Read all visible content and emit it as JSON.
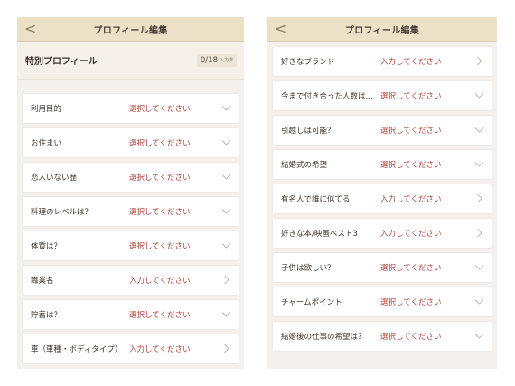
{
  "left_screen": {
    "header": {
      "title": "プロフィール編集",
      "back_icon": "back-chevron-icon"
    },
    "special": {
      "title": "特別プロフィール",
      "count": "0/18",
      "count_suffix": "入力済"
    },
    "rows": [
      {
        "label": "利用目的",
        "value": "選択してください",
        "icon": "chevron-down-icon"
      },
      {
        "label": "お住まい",
        "value": "選択してください",
        "icon": "chevron-down-icon"
      },
      {
        "label": "恋人いない歴",
        "value": "選択してください",
        "icon": "chevron-down-icon"
      },
      {
        "label": "料理のレベルは？",
        "value": "選択してください",
        "icon": "chevron-down-icon"
      },
      {
        "label": "体質は？",
        "value": "選択してください",
        "icon": "chevron-down-icon"
      },
      {
        "label": "職業名",
        "value": "入力してください",
        "icon": "chevron-right-icon"
      },
      {
        "label": "貯蓄は？",
        "value": "選択してください",
        "icon": "chevron-down-icon"
      },
      {
        "label": "車（車種・ボディタイプ）",
        "value": "入力してください",
        "icon": "chevron-right-icon"
      }
    ]
  },
  "right_screen": {
    "header": {
      "title": "プロフィール編集",
      "back_icon": "back-chevron-icon"
    },
    "rows": [
      {
        "label": "好きなブランド",
        "value": "入力してください",
        "icon": "chevron-right-icon"
      },
      {
        "label": "今まで付き合った人数は…",
        "value": "選択してください",
        "icon": "chevron-down-icon"
      },
      {
        "label": "引越しは可能？",
        "value": "選択してください",
        "icon": "chevron-down-icon"
      },
      {
        "label": "結婚式の希望",
        "value": "選択してください",
        "icon": "chevron-down-icon"
      },
      {
        "label": "有名人で誰に似てる",
        "value": "入力してください",
        "icon": "chevron-right-icon"
      },
      {
        "label": "好きな本/映画ベスト3",
        "value": "入力してください",
        "icon": "chevron-right-icon"
      },
      {
        "label": "子供は欲しい？",
        "value": "選択してください",
        "icon": "chevron-down-icon"
      },
      {
        "label": "チャームポイント",
        "value": "選択してください",
        "icon": "chevron-down-icon"
      },
      {
        "label": "結婚後の仕事の希望は？",
        "value": "選択してください",
        "icon": "chevron-down-icon"
      }
    ]
  },
  "colors": {
    "header_bg": "#ece1c6",
    "value_text": "#b0443c",
    "screen_bg": "#f3f0ee"
  }
}
